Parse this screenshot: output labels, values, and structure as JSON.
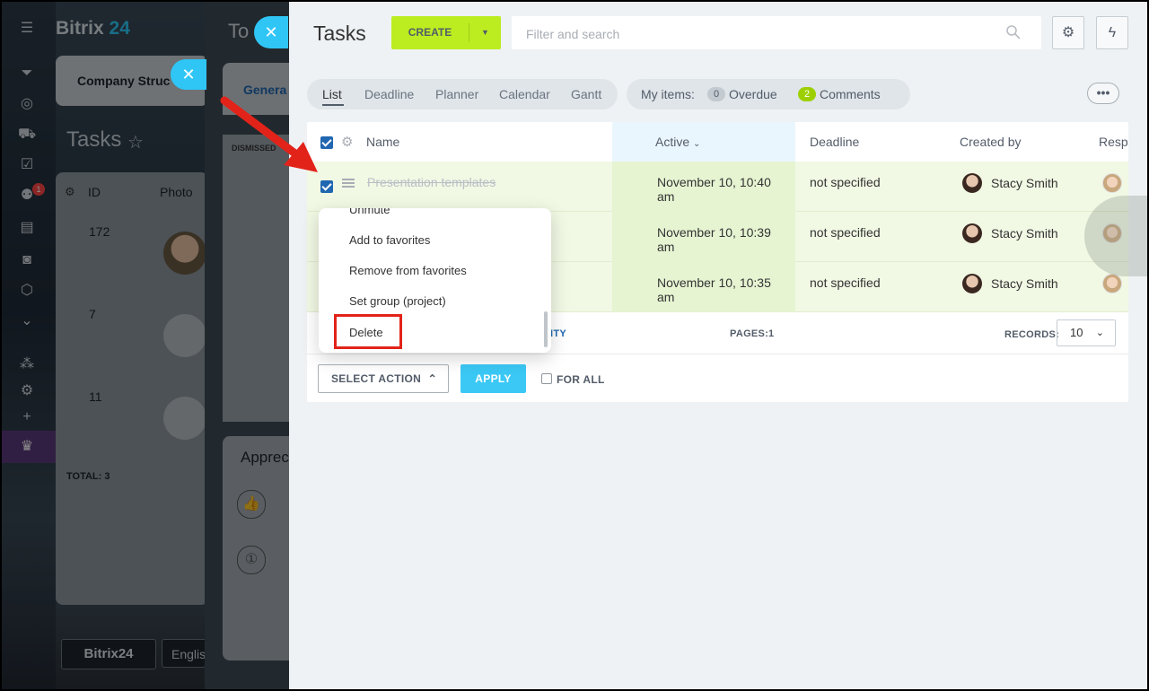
{
  "background": {
    "logo_text": "Bitrix",
    "logo_num": "24",
    "company_structure": "Company Struc",
    "general_tab": "Genera",
    "dismissed_label": "DISMISSED",
    "tasks_title": "Tasks",
    "table_headers": {
      "id": "ID",
      "photo": "Photo"
    },
    "rows": [
      "172",
      "7",
      "11"
    ],
    "total": "TOTAL: 3",
    "appreciation": "Apprec",
    "footer_logo": "Bitrix24",
    "footer_lang": "Englis",
    "slider_title": "To",
    "nav_badge": "1"
  },
  "header": {
    "title": "Tasks",
    "create_label": "CREATE",
    "search_placeholder": "Filter and search"
  },
  "views": {
    "tabs": [
      "List",
      "Deadline",
      "Planner",
      "Calendar",
      "Gantt"
    ],
    "active": "List"
  },
  "counters": {
    "label": "My items:",
    "overdue_count": "0",
    "overdue_label": "Overdue",
    "comments_count": "2",
    "comments_label": "Comments"
  },
  "grid": {
    "columns": {
      "name": "Name",
      "active": "Active",
      "deadline": "Deadline",
      "created_by": "Created by",
      "responsible": "Resp"
    },
    "rows": [
      {
        "name": "Presentation templates",
        "active": "November 10, 10:40 am",
        "deadline": "not specified",
        "created_by": "Stacy Smith"
      },
      {
        "name": "",
        "active": "November 10, 10:39 am",
        "deadline": "not specified",
        "created_by": "Stacy Smith"
      },
      {
        "name": "",
        "active": "November 10, 10:35 am",
        "deadline": "not specified",
        "created_by": "Stacy Smith"
      }
    ],
    "footer": {
      "ity": "ITY",
      "pages_label": "PAGES:",
      "pages_value": "1",
      "records_label": "RECORDS:",
      "records_value": "10"
    },
    "action_bar": {
      "select_action": "SELECT ACTION",
      "apply": "APPLY",
      "for_all": "FOR ALL"
    }
  },
  "popup_menu": {
    "items": [
      "Unmute",
      "Add to favorites",
      "Remove from favorites",
      "Set group (project)",
      "Delete"
    ]
  },
  "colors": {
    "accent_blue": "#2fc6f6",
    "create_green": "#bbed21",
    "highlight_red": "#e2231a"
  }
}
